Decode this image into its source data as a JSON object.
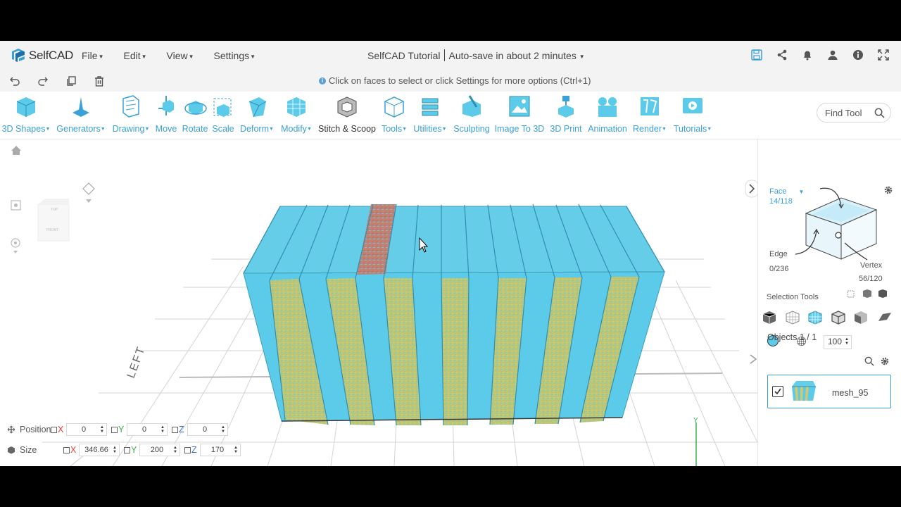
{
  "app": {
    "name": "SelfCAD",
    "menu": [
      "File",
      "Edit",
      "View",
      "Settings"
    ],
    "project_title": "SelfCAD Tutorial",
    "autosave": "Auto-save in about 2 minutes"
  },
  "hint": "Click on faces to select or click Settings for more options (Ctrl+1)",
  "toolbar": {
    "tools": [
      {
        "label": "3D Shapes",
        "caret": true
      },
      {
        "label": "Generators",
        "caret": true
      },
      {
        "label": "Drawing",
        "caret": true
      },
      {
        "label": "Move",
        "caret": false
      },
      {
        "label": "Rotate",
        "caret": false
      },
      {
        "label": "Scale",
        "caret": false
      },
      {
        "label": "Deform",
        "caret": true
      },
      {
        "label": "Modify",
        "caret": true
      },
      {
        "label": "Stitch & Scoop",
        "caret": false
      },
      {
        "label": "Tools",
        "caret": true
      },
      {
        "label": "Utilities",
        "caret": true
      },
      {
        "label": "Sculpting",
        "caret": false
      },
      {
        "label": "Image To 3D",
        "caret": false
      },
      {
        "label": "3D Print",
        "caret": false
      },
      {
        "label": "Animation",
        "caret": false
      },
      {
        "label": "Render",
        "caret": true
      },
      {
        "label": "Tutorials",
        "caret": true
      }
    ],
    "find_tool_placeholder": "Find Tool"
  },
  "viewcube": {
    "top": "TOP",
    "front": "FRONT"
  },
  "grid_label": "LEFT",
  "selection_panel": {
    "face_label": "Face",
    "face_count": "14/118",
    "edge_label": "Edge",
    "edge_count": "0/236",
    "vertex_label": "Vertex",
    "vertex_count": "56/120",
    "selection_tools_label": "Selection Tools",
    "opacity_value": "100"
  },
  "objects": {
    "header": "Objects 1 / 1",
    "items": [
      {
        "name": "mesh_95",
        "checked": true
      }
    ]
  },
  "transform": {
    "position_label": "Position",
    "size_label": "Size",
    "position": {
      "x": "0",
      "y": "0",
      "z": "0"
    },
    "size": {
      "x": "346.66",
      "y": "200",
      "z": "170"
    }
  },
  "axis_gizmo": {
    "y": "Y",
    "x": "X",
    "z": "Z"
  },
  "colors": {
    "accent": "#3aa0d8",
    "model": "#5ccbea",
    "selected_face": "#c8694e",
    "texture": "#d4c96a"
  }
}
